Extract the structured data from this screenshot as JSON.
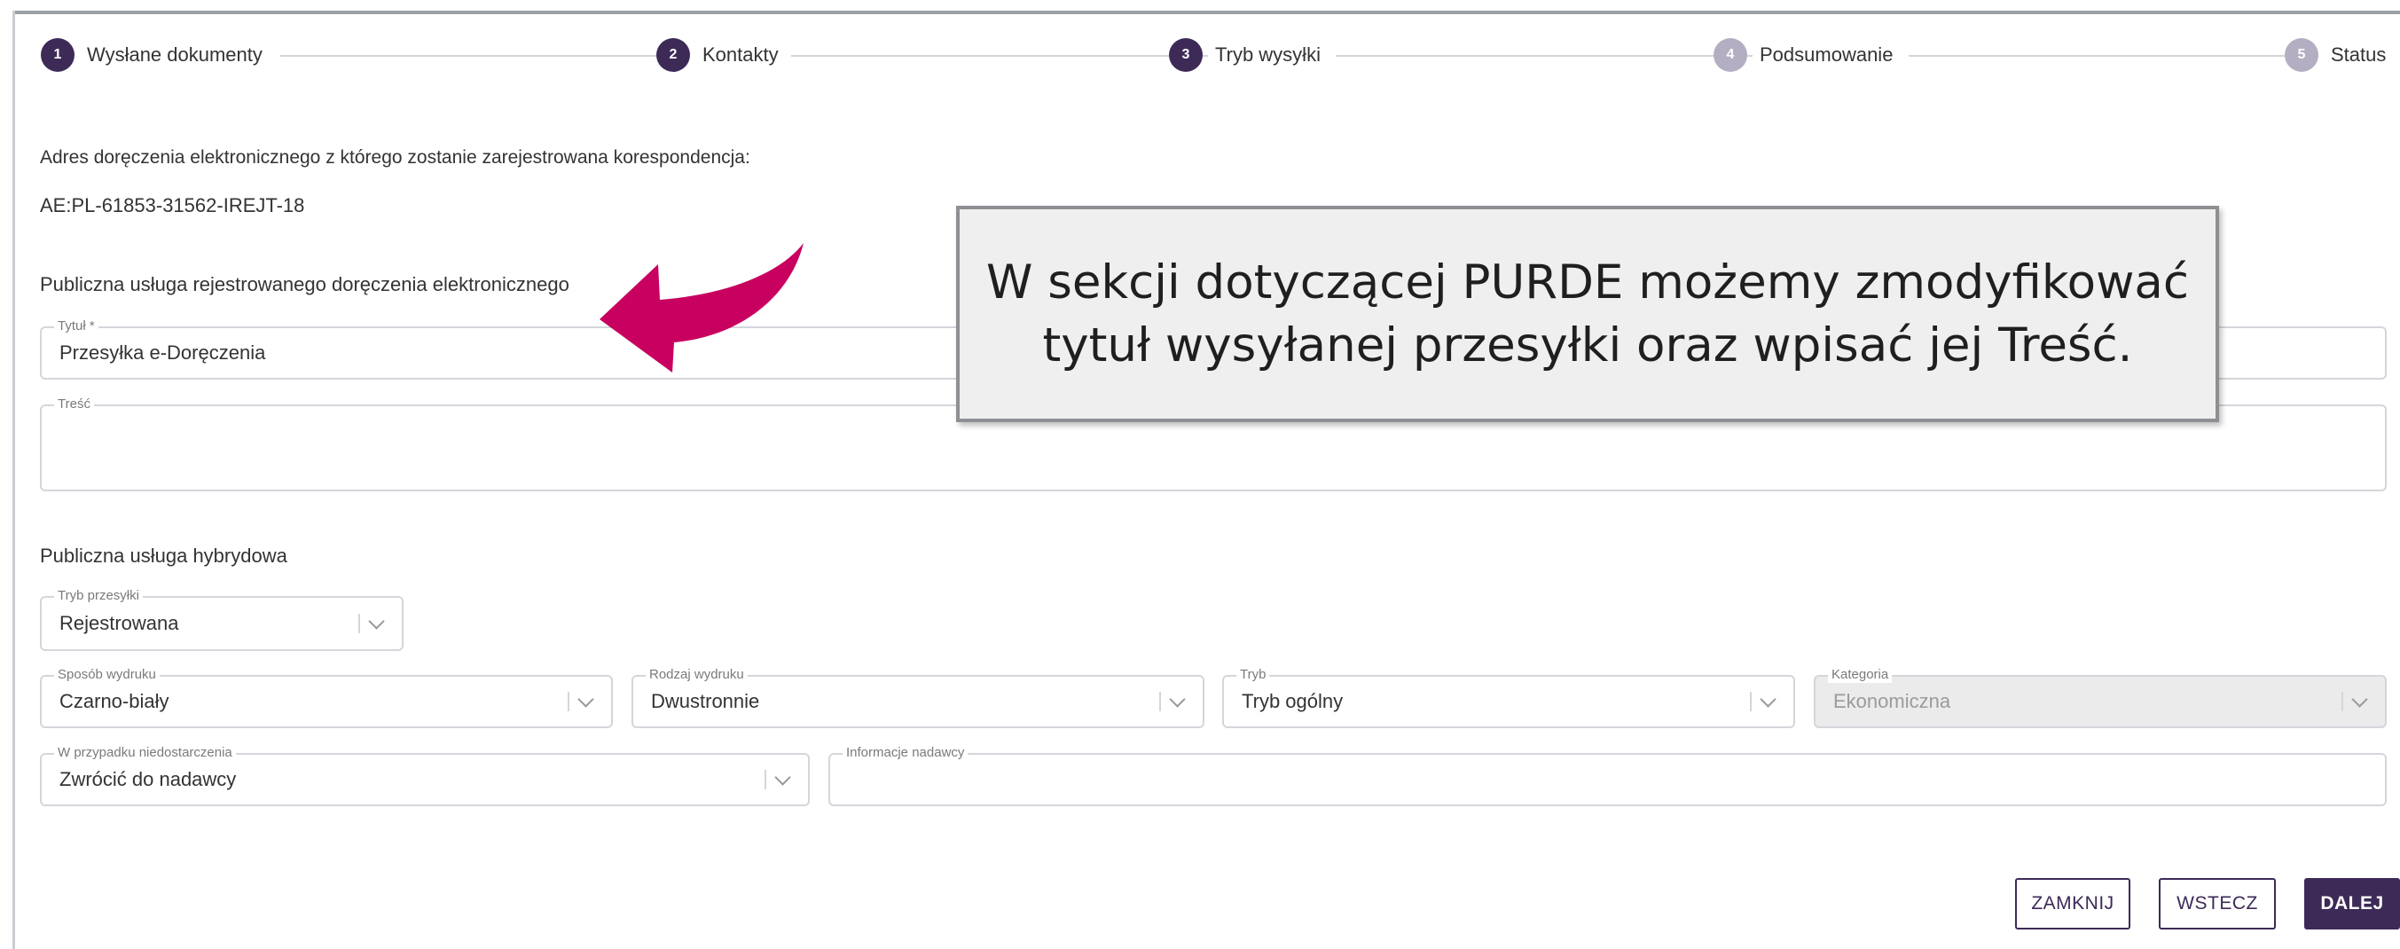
{
  "stepper": {
    "steps": [
      {
        "num": "1",
        "label": "Wysłane dokumenty",
        "state": "done"
      },
      {
        "num": "2",
        "label": "Kontakty",
        "state": "done"
      },
      {
        "num": "3",
        "label": "Tryb wysyłki",
        "state": "done"
      },
      {
        "num": "4",
        "label": "Podsumowanie",
        "state": "todo"
      },
      {
        "num": "5",
        "label": "Status",
        "state": "todo"
      }
    ]
  },
  "address": {
    "label": "Adres doręczenia elektronicznego z którego zostanie zarejestrowana korespondencja:",
    "value": "AE:PL-61853-31562-IREJT-18"
  },
  "purde": {
    "section_title": "Publiczna usługa rejestrowanego doręczenia elektronicznego",
    "title_label": "Tytuł *",
    "title_value": "Przesyłka e-Doręczenia",
    "content_label": "Treść",
    "content_value": ""
  },
  "hybrid": {
    "section_title": "Publiczna usługa hybrydowa",
    "tryb_przesylki": {
      "label": "Tryb przesyłki",
      "value": "Rejestrowana"
    },
    "sposob_wydruku": {
      "label": "Sposób wydruku",
      "value": "Czarno-biały"
    },
    "rodzaj_wydruku": {
      "label": "Rodzaj wydruku",
      "value": "Dwustronnie"
    },
    "tryb": {
      "label": "Tryb",
      "value": "Tryb ogólny"
    },
    "kategoria": {
      "label": "Kategoria",
      "value": "Ekonomiczna"
    },
    "niedostarczenie": {
      "label": "W przypadku niedostarczenia",
      "value": "Zwrócić do nadawcy"
    },
    "informacje": {
      "label": "Informacje nadawcy",
      "value": ""
    }
  },
  "buttons": {
    "close": "ZAMKNIJ",
    "back": "WSTECZ",
    "next": "DALEJ"
  },
  "callout": {
    "text": "W sekcji dotyczącej PURDE możemy zmodyfikować tytuł wysyłanej przesyłki oraz wpisać jej Treść."
  },
  "colors": {
    "accent": "#3d2a57",
    "step_inactive": "#b4aec2",
    "arrow": "#c8005f"
  }
}
